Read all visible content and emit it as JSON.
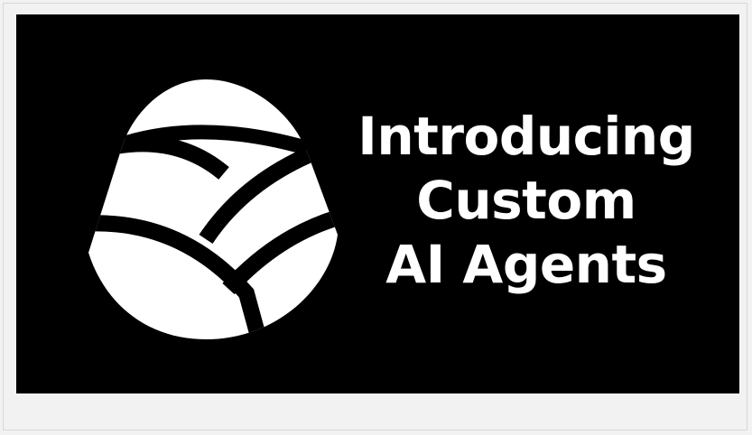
{
  "banner": {
    "headline_lines": [
      "Introducing",
      "Custom",
      "AI Agents"
    ],
    "logo_icon": "leaf-bud-logo-icon"
  },
  "colors": {
    "banner_background": "#000000",
    "text": "#ffffff",
    "page_background": "#f2f2f2"
  }
}
